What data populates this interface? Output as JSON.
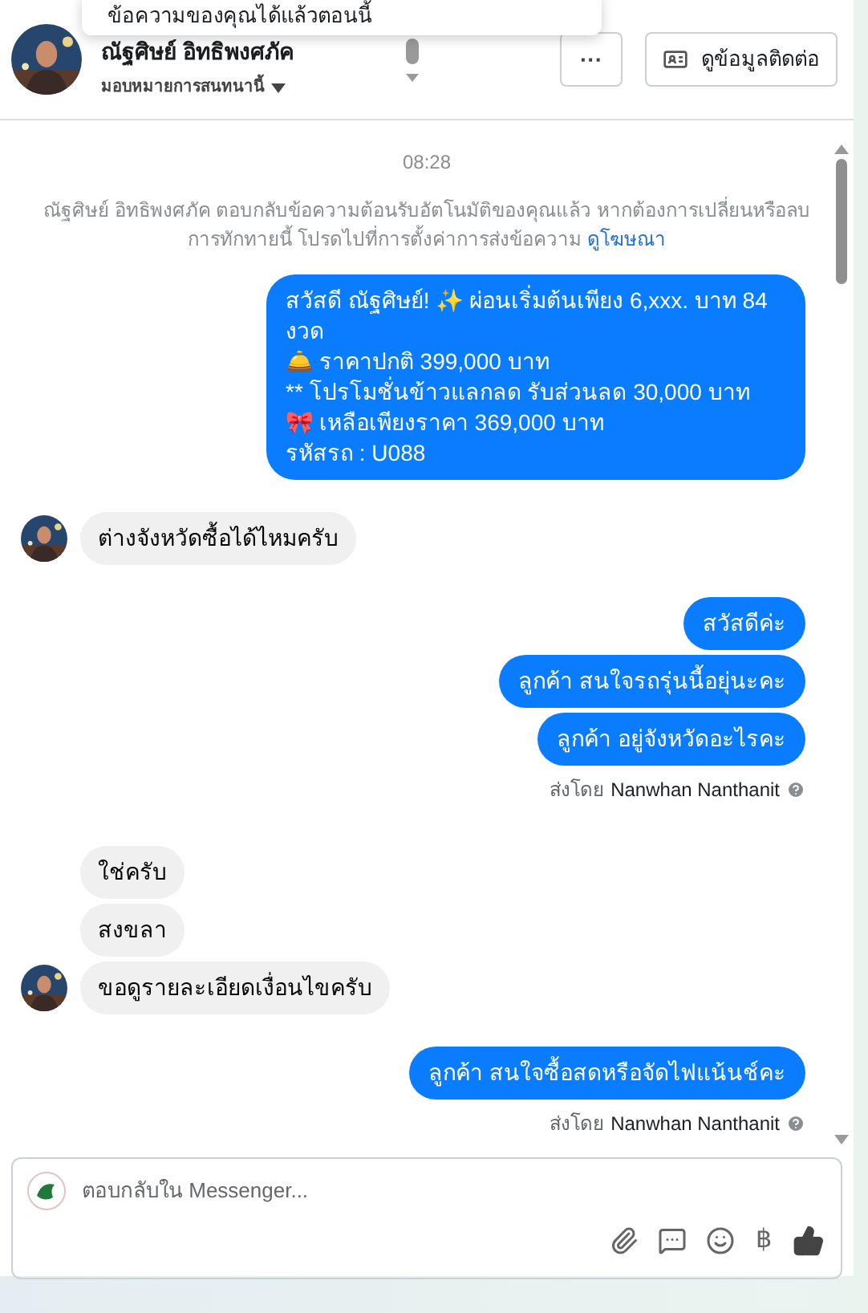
{
  "tooltip": {
    "text": "ข้อความของคุณได้แล้วตอนนี้"
  },
  "header": {
    "name": "ณัฐศิษย์ อิทธิพงศภัค",
    "assign": "มอบหมายการสนทนานี้",
    "more_button": "···",
    "contact_button": "ดูข้อมูลติดต่อ"
  },
  "chat": {
    "time": "08:28",
    "notice": "ณัฐศิษย์ อิทธิพงศภัค ตอบกลับข้อความต้อนรับอัตโนมัติของคุณแล้ว หากต้องการเปลี่ยนหรือลบการทักทายนี้ โปรดไปที่การตั้งค่าการส่งข้อความ",
    "notice_link": "ดูโฆษณา",
    "messages": [
      {
        "kind": "outgoing",
        "text": "สวัสดี ณัฐศิษย์! ✨  ผ่อนเริ่มต้นเพียง 6,xxx. บาท 84 งวด\n🛎️ ราคาปกติ 399,000 บาท\n** โปรโมชั่นข้าวแลกลด รับส่วนลด 30,000 บาท\n🎀  เหลือเพียงราคา 369,000 บาท\n รหัสรถ : U088"
      },
      {
        "kind": "incoming",
        "avatar": true,
        "text": "ต่างจังหวัดซื้อได้ไหมครับ"
      },
      {
        "kind": "outgoing",
        "text": "สวัสดีค่ะ"
      },
      {
        "kind": "outgoing",
        "text": "ลูกค้า สนใจรถรุ่นนี้อยุ่นะคะ"
      },
      {
        "kind": "outgoing",
        "text": "ลูกค้า อยู่จังหวัดอะไรคะ"
      },
      {
        "kind": "sent-by",
        "label": "ส่งโดย",
        "text": "Nanwhan Nanthanit"
      },
      {
        "kind": "incoming",
        "avatar": false,
        "text": "ใช่ครับ"
      },
      {
        "kind": "incoming",
        "avatar": false,
        "text": "สงขลา"
      },
      {
        "kind": "incoming",
        "avatar": true,
        "text": "ขอดูรายละเอียดเงื่อนไขครับ"
      },
      {
        "kind": "outgoing",
        "text": "ลูกค้า สนใจซื้อสดหรือจัดไฟแน้นช์คะ"
      },
      {
        "kind": "sent-by",
        "label": "ส่งโดย",
        "text": "Nanwhan Nanthanit"
      }
    ]
  },
  "composer": {
    "placeholder": "ตอบกลับใน Messenger...",
    "baht": "฿"
  }
}
